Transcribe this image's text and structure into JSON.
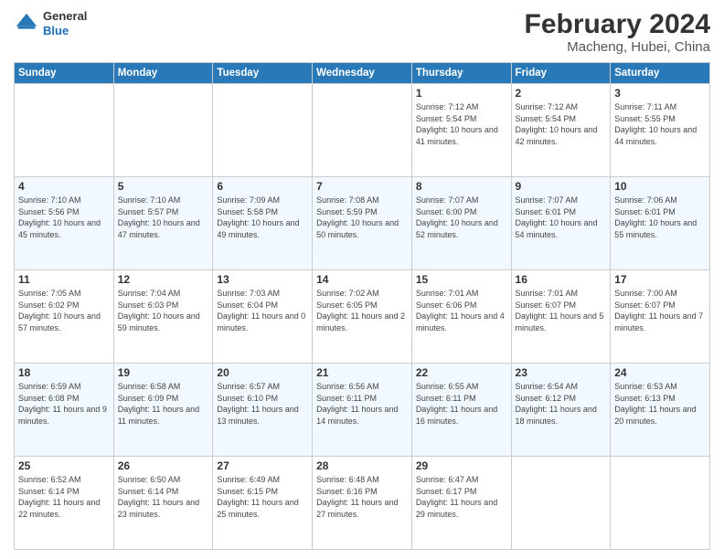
{
  "header": {
    "logo": {
      "general": "General",
      "blue": "Blue"
    },
    "title": "February 2024",
    "location": "Macheng, Hubei, China"
  },
  "weekdays": [
    "Sunday",
    "Monday",
    "Tuesday",
    "Wednesday",
    "Thursday",
    "Friday",
    "Saturday"
  ],
  "weeks": [
    [
      {
        "day": "",
        "sunrise": "",
        "sunset": "",
        "daylight": ""
      },
      {
        "day": "",
        "sunrise": "",
        "sunset": "",
        "daylight": ""
      },
      {
        "day": "",
        "sunrise": "",
        "sunset": "",
        "daylight": ""
      },
      {
        "day": "",
        "sunrise": "",
        "sunset": "",
        "daylight": ""
      },
      {
        "day": "1",
        "sunrise": "Sunrise: 7:12 AM",
        "sunset": "Sunset: 5:54 PM",
        "daylight": "Daylight: 10 hours and 41 minutes."
      },
      {
        "day": "2",
        "sunrise": "Sunrise: 7:12 AM",
        "sunset": "Sunset: 5:54 PM",
        "daylight": "Daylight: 10 hours and 42 minutes."
      },
      {
        "day": "3",
        "sunrise": "Sunrise: 7:11 AM",
        "sunset": "Sunset: 5:55 PM",
        "daylight": "Daylight: 10 hours and 44 minutes."
      }
    ],
    [
      {
        "day": "4",
        "sunrise": "Sunrise: 7:10 AM",
        "sunset": "Sunset: 5:56 PM",
        "daylight": "Daylight: 10 hours and 45 minutes."
      },
      {
        "day": "5",
        "sunrise": "Sunrise: 7:10 AM",
        "sunset": "Sunset: 5:57 PM",
        "daylight": "Daylight: 10 hours and 47 minutes."
      },
      {
        "day": "6",
        "sunrise": "Sunrise: 7:09 AM",
        "sunset": "Sunset: 5:58 PM",
        "daylight": "Daylight: 10 hours and 49 minutes."
      },
      {
        "day": "7",
        "sunrise": "Sunrise: 7:08 AM",
        "sunset": "Sunset: 5:59 PM",
        "daylight": "Daylight: 10 hours and 50 minutes."
      },
      {
        "day": "8",
        "sunrise": "Sunrise: 7:07 AM",
        "sunset": "Sunset: 6:00 PM",
        "daylight": "Daylight: 10 hours and 52 minutes."
      },
      {
        "day": "9",
        "sunrise": "Sunrise: 7:07 AM",
        "sunset": "Sunset: 6:01 PM",
        "daylight": "Daylight: 10 hours and 54 minutes."
      },
      {
        "day": "10",
        "sunrise": "Sunrise: 7:06 AM",
        "sunset": "Sunset: 6:01 PM",
        "daylight": "Daylight: 10 hours and 55 minutes."
      }
    ],
    [
      {
        "day": "11",
        "sunrise": "Sunrise: 7:05 AM",
        "sunset": "Sunset: 6:02 PM",
        "daylight": "Daylight: 10 hours and 57 minutes."
      },
      {
        "day": "12",
        "sunrise": "Sunrise: 7:04 AM",
        "sunset": "Sunset: 6:03 PM",
        "daylight": "Daylight: 10 hours and 59 minutes."
      },
      {
        "day": "13",
        "sunrise": "Sunrise: 7:03 AM",
        "sunset": "Sunset: 6:04 PM",
        "daylight": "Daylight: 11 hours and 0 minutes."
      },
      {
        "day": "14",
        "sunrise": "Sunrise: 7:02 AM",
        "sunset": "Sunset: 6:05 PM",
        "daylight": "Daylight: 11 hours and 2 minutes."
      },
      {
        "day": "15",
        "sunrise": "Sunrise: 7:01 AM",
        "sunset": "Sunset: 6:06 PM",
        "daylight": "Daylight: 11 hours and 4 minutes."
      },
      {
        "day": "16",
        "sunrise": "Sunrise: 7:01 AM",
        "sunset": "Sunset: 6:07 PM",
        "daylight": "Daylight: 11 hours and 5 minutes."
      },
      {
        "day": "17",
        "sunrise": "Sunrise: 7:00 AM",
        "sunset": "Sunset: 6:07 PM",
        "daylight": "Daylight: 11 hours and 7 minutes."
      }
    ],
    [
      {
        "day": "18",
        "sunrise": "Sunrise: 6:59 AM",
        "sunset": "Sunset: 6:08 PM",
        "daylight": "Daylight: 11 hours and 9 minutes."
      },
      {
        "day": "19",
        "sunrise": "Sunrise: 6:58 AM",
        "sunset": "Sunset: 6:09 PM",
        "daylight": "Daylight: 11 hours and 11 minutes."
      },
      {
        "day": "20",
        "sunrise": "Sunrise: 6:57 AM",
        "sunset": "Sunset: 6:10 PM",
        "daylight": "Daylight: 11 hours and 13 minutes."
      },
      {
        "day": "21",
        "sunrise": "Sunrise: 6:56 AM",
        "sunset": "Sunset: 6:11 PM",
        "daylight": "Daylight: 11 hours and 14 minutes."
      },
      {
        "day": "22",
        "sunrise": "Sunrise: 6:55 AM",
        "sunset": "Sunset: 6:11 PM",
        "daylight": "Daylight: 11 hours and 16 minutes."
      },
      {
        "day": "23",
        "sunrise": "Sunrise: 6:54 AM",
        "sunset": "Sunset: 6:12 PM",
        "daylight": "Daylight: 11 hours and 18 minutes."
      },
      {
        "day": "24",
        "sunrise": "Sunrise: 6:53 AM",
        "sunset": "Sunset: 6:13 PM",
        "daylight": "Daylight: 11 hours and 20 minutes."
      }
    ],
    [
      {
        "day": "25",
        "sunrise": "Sunrise: 6:52 AM",
        "sunset": "Sunset: 6:14 PM",
        "daylight": "Daylight: 11 hours and 22 minutes."
      },
      {
        "day": "26",
        "sunrise": "Sunrise: 6:50 AM",
        "sunset": "Sunset: 6:14 PM",
        "daylight": "Daylight: 11 hours and 23 minutes."
      },
      {
        "day": "27",
        "sunrise": "Sunrise: 6:49 AM",
        "sunset": "Sunset: 6:15 PM",
        "daylight": "Daylight: 11 hours and 25 minutes."
      },
      {
        "day": "28",
        "sunrise": "Sunrise: 6:48 AM",
        "sunset": "Sunset: 6:16 PM",
        "daylight": "Daylight: 11 hours and 27 minutes."
      },
      {
        "day": "29",
        "sunrise": "Sunrise: 6:47 AM",
        "sunset": "Sunset: 6:17 PM",
        "daylight": "Daylight: 11 hours and 29 minutes."
      },
      {
        "day": "",
        "sunrise": "",
        "sunset": "",
        "daylight": ""
      },
      {
        "day": "",
        "sunrise": "",
        "sunset": "",
        "daylight": ""
      }
    ]
  ]
}
